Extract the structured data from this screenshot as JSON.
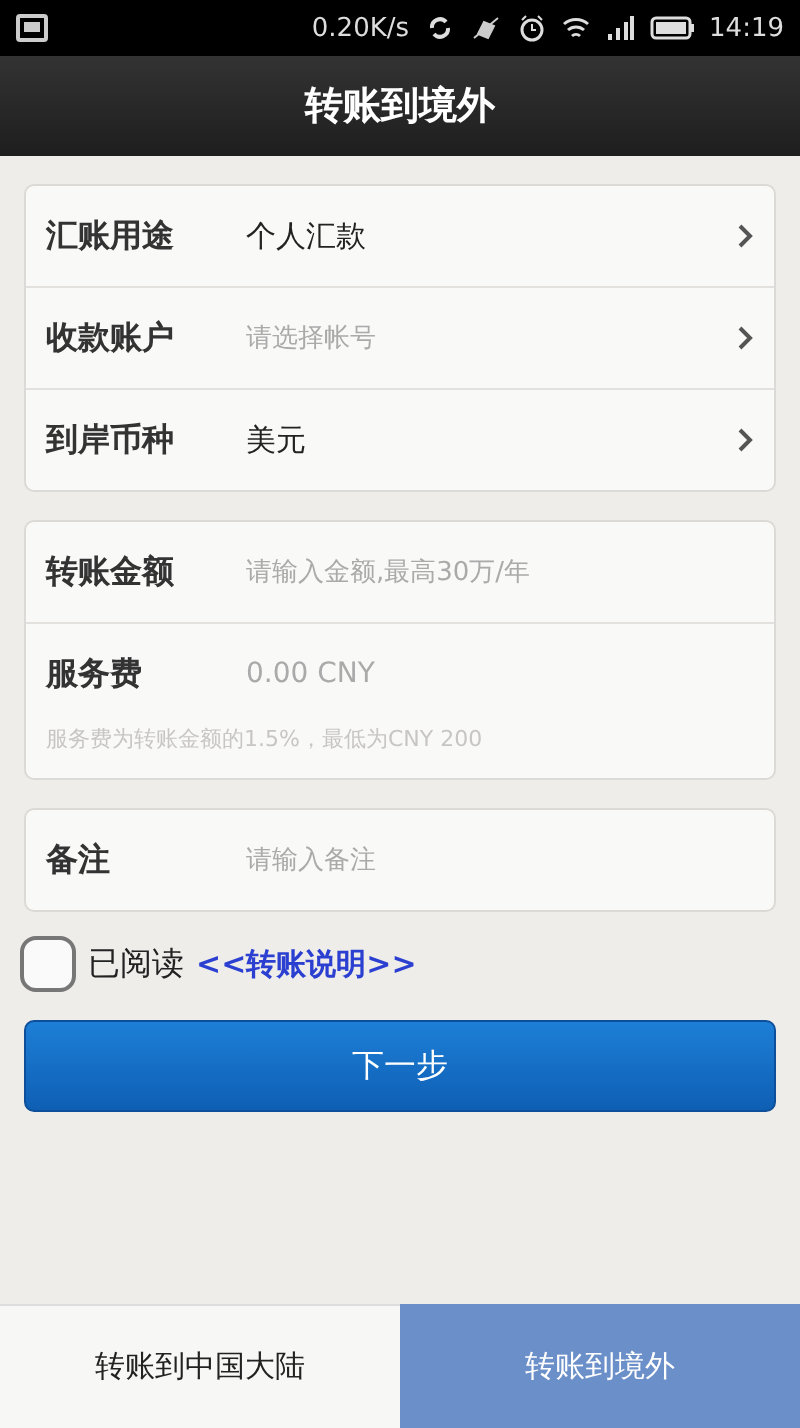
{
  "status_bar": {
    "speed": "0.20K/s",
    "time": "14:19"
  },
  "title": "转账到境外",
  "groups": [
    {
      "rows": [
        {
          "kind": "select",
          "label": "汇账用途",
          "value": "个人汇款"
        },
        {
          "kind": "select",
          "label": "收款账户",
          "placeholder": "请选择帐号"
        },
        {
          "kind": "select",
          "label": "到岸币种",
          "value": "美元"
        }
      ]
    },
    {
      "rows": [
        {
          "kind": "input",
          "label": "转账金额",
          "placeholder": "请输入金额,最高30万/年"
        },
        {
          "kind": "display",
          "label": "服务费",
          "value": "0.00 CNY"
        },
        {
          "kind": "note",
          "text": "服务费为转账金额的1.5%，最低为CNY 200"
        }
      ]
    },
    {
      "rows": [
        {
          "kind": "input",
          "label": "备注",
          "placeholder": "请输入备注"
        }
      ]
    }
  ],
  "agreement": {
    "checked": false,
    "text": "已阅读",
    "link": "<<转账说明>>"
  },
  "next_button": "下一步",
  "tabs": [
    {
      "label": "转账到中国大陆",
      "selected": false
    },
    {
      "label": "转账到境外",
      "selected": true
    }
  ]
}
